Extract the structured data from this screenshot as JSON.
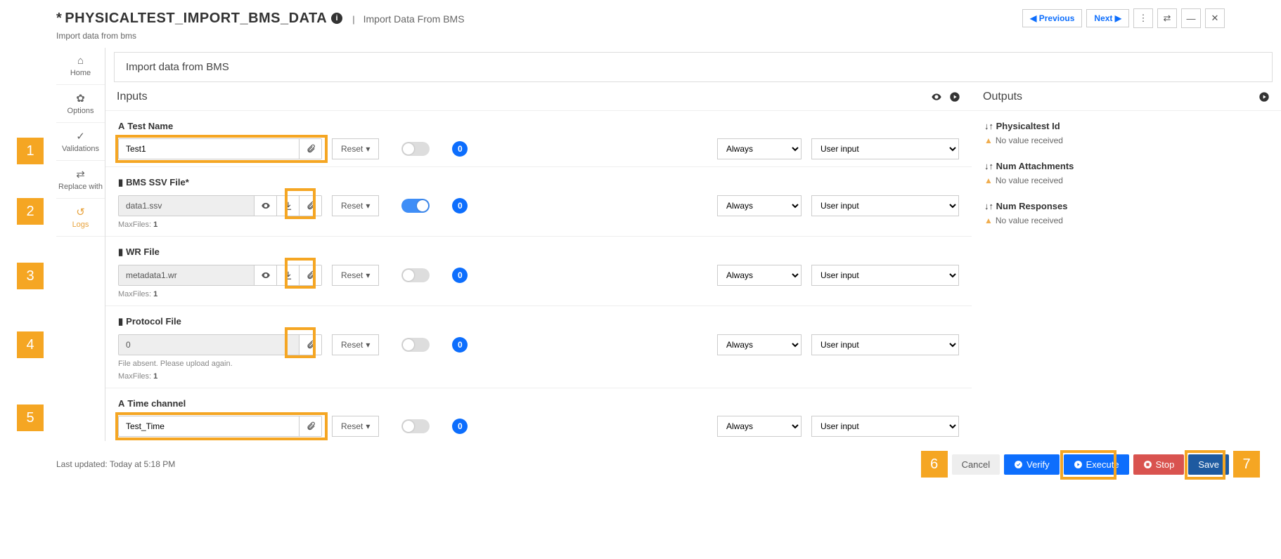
{
  "header": {
    "modified_indicator": "*",
    "title": "PHYSICALTEST_IMPORT_BMS_DATA",
    "subtitle": "Import Data From BMS",
    "prev_label": "Previous",
    "next_label": "Next",
    "description": "Import data from bms"
  },
  "sidebar": {
    "home": "Home",
    "options": "Options",
    "validations": "Validations",
    "replace": "Replace with",
    "logs": "Logs"
  },
  "desc_bar": "Import data from BMS",
  "inputs_panel": {
    "title": "Inputs",
    "reset_label": "Reset",
    "always_option": "Always",
    "user_input_option": "User input",
    "maxfiles_label": "MaxFiles:",
    "fields": {
      "test_name": {
        "label": "Test Name",
        "value": "Test1",
        "badge": "0",
        "always": "Always",
        "source": "User input"
      },
      "bms_ssv": {
        "label": "BMS SSV File",
        "value": "data1.ssv",
        "badge": "0",
        "always": "Always",
        "source": "User input",
        "maxfiles": "1"
      },
      "wr_file": {
        "label": "WR File",
        "value": "metadata1.wr",
        "badge": "0",
        "always": "Always",
        "source": "User input",
        "maxfiles": "1"
      },
      "protocol": {
        "label": "Protocol File",
        "value": "0",
        "badge": "0",
        "always": "Always",
        "source": "User input",
        "absent_msg": "File absent. Please upload again.",
        "maxfiles": "1"
      },
      "time_channel": {
        "label": "Time channel",
        "value": "Test_Time",
        "badge": "0",
        "always": "Always",
        "source": "User input"
      }
    }
  },
  "outputs_panel": {
    "title": "Outputs",
    "no_value": "No value received",
    "items": {
      "pt_id": "Physicaltest Id",
      "num_attach": "Num Attachments",
      "num_resp": "Num Responses"
    }
  },
  "footer": {
    "last_updated": "Last updated: Today at 5:18 PM",
    "cancel": "Cancel",
    "verify": "Verify",
    "execute": "Execute",
    "stop": "Stop",
    "save": "Save"
  },
  "step_markers": [
    "1",
    "2",
    "3",
    "4",
    "5",
    "6",
    "7"
  ]
}
